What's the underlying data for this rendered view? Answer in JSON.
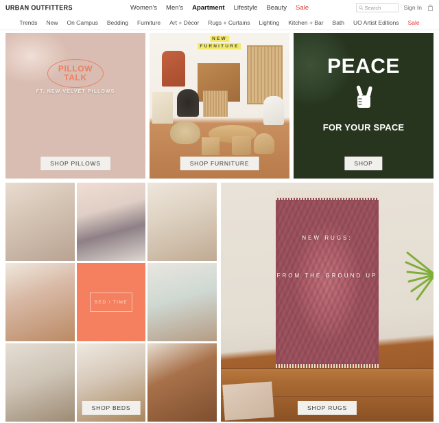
{
  "header": {
    "logo": "URBAN OUTFITTERS",
    "primary_nav": [
      {
        "label": "Women's",
        "style": "normal"
      },
      {
        "label": "Men's",
        "style": "normal"
      },
      {
        "label": "Apartment",
        "style": "active"
      },
      {
        "label": "Lifestyle",
        "style": "normal"
      },
      {
        "label": "Beauty",
        "style": "normal"
      },
      {
        "label": "Sale",
        "style": "sale"
      }
    ],
    "search": {
      "placeholder": "Search",
      "icon": "search-icon"
    },
    "sign_in": "Sign In",
    "bag_icon": "shopping-bag-icon"
  },
  "subnav": [
    {
      "label": "Trends",
      "style": "normal"
    },
    {
      "label": "New",
      "style": "normal"
    },
    {
      "label": "On Campus",
      "style": "normal"
    },
    {
      "label": "Bedding",
      "style": "normal"
    },
    {
      "label": "Furniture",
      "style": "normal"
    },
    {
      "label": "Art + Décor",
      "style": "normal"
    },
    {
      "label": "Rugs + Curtains",
      "style": "normal"
    },
    {
      "label": "Lighting",
      "style": "normal"
    },
    {
      "label": "Kitchen + Bar",
      "style": "normal"
    },
    {
      "label": "Bath",
      "style": "normal"
    },
    {
      "label": "UO Artist Editions",
      "style": "normal"
    },
    {
      "label": "Sale",
      "style": "sale"
    }
  ],
  "hero": {
    "pillow": {
      "title_line1": "PILLOW",
      "title_line2": "TALK",
      "subtitle": "FT. NEW VELVET PILLOWS",
      "cta": "SHOP PILLOWS"
    },
    "furniture": {
      "label_line1": "NEW",
      "label_line2": "FURNITURE",
      "cta": "SHOP FURNITURE"
    },
    "peace": {
      "title": "PEACE",
      "icon": "peace-hand-icon",
      "subtitle": "FOR YOUR SPACE",
      "cta": "SHOP"
    }
  },
  "beds": {
    "overlay_label": "BED / TIME",
    "cta": "SHOP BEDS"
  },
  "rugs": {
    "line1": "NEW RUGS:",
    "line2": "FROM THE GROUND UP",
    "cta": "SHOP RUGS"
  },
  "colors": {
    "sale_red": "#e03a36",
    "coral": "#f4805f",
    "pillow_coral": "#ef7f5e",
    "highlight_yellow": "#f3e96b",
    "button_bg": "#f2f0ec"
  }
}
